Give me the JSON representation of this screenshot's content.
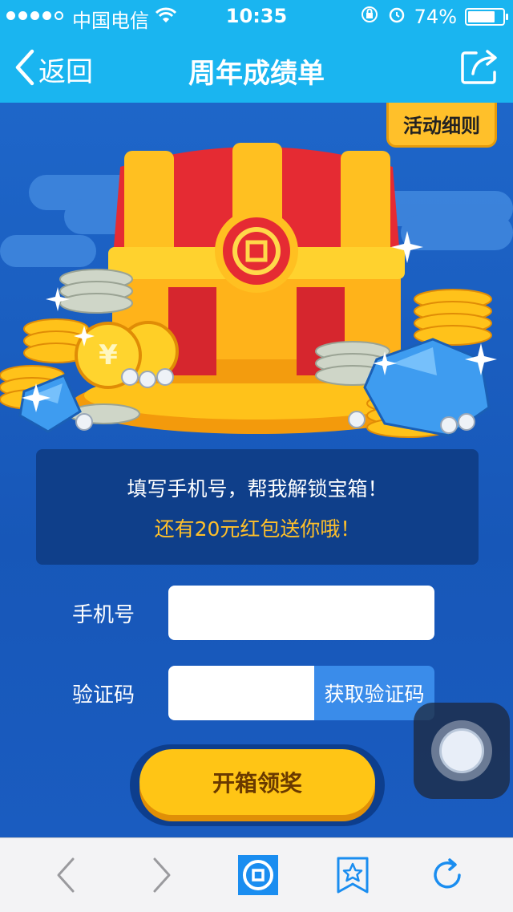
{
  "status_bar": {
    "carrier": "中国电信",
    "time": "10:35",
    "battery": "74%"
  },
  "nav": {
    "back_label": "返回",
    "title": "周年成绩单"
  },
  "rules_button": "活动细则",
  "message": {
    "line1": "填写手机号，帮我解锁宝箱！",
    "line2": "还有20元红包送你哦！"
  },
  "form": {
    "phone_label": "手机号",
    "phone_value": "",
    "code_label": "验证码",
    "code_value": "",
    "get_code_button": "获取验证码"
  },
  "open_button": "开箱领奖",
  "colors": {
    "header": "#1ab5f0",
    "background": "#1b64c6",
    "accent_yellow": "#ffc02a",
    "chest_red": "#d6262e"
  }
}
